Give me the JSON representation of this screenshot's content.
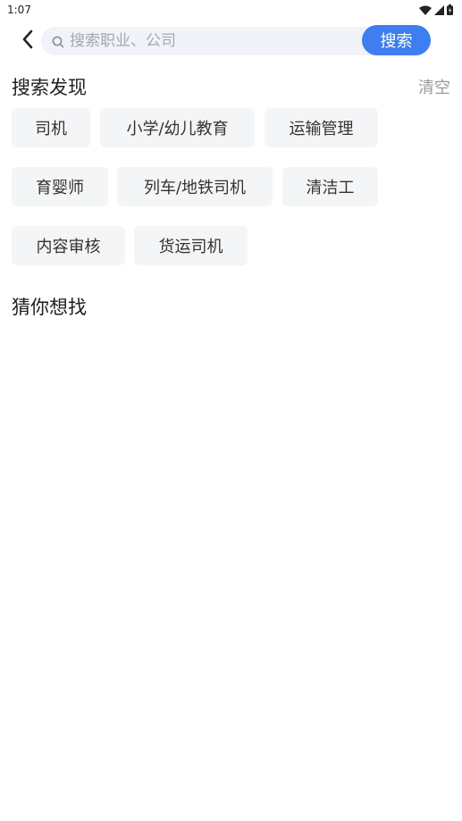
{
  "status_bar": {
    "time": "1:07",
    "icons": [
      "wifi-icon",
      "signal-icon",
      "battery-icon"
    ]
  },
  "header": {
    "search": {
      "placeholder": "搜索职业、公司",
      "value": ""
    },
    "search_button_label": "搜索"
  },
  "discover": {
    "title": "搜索发现",
    "clear_label": "清空",
    "tags": [
      "司机",
      "小学/幼儿教育",
      "运输管理",
      "育婴师",
      "列车/地铁司机",
      "清洁工",
      "内容审核",
      "货运司机"
    ]
  },
  "guess": {
    "title": "猜你想找"
  },
  "colors": {
    "accent": "#3e7ef0",
    "search_bg": "#f1f3f8",
    "tag_bg": "#f4f5f7",
    "muted_text": "#9a9a9a"
  }
}
